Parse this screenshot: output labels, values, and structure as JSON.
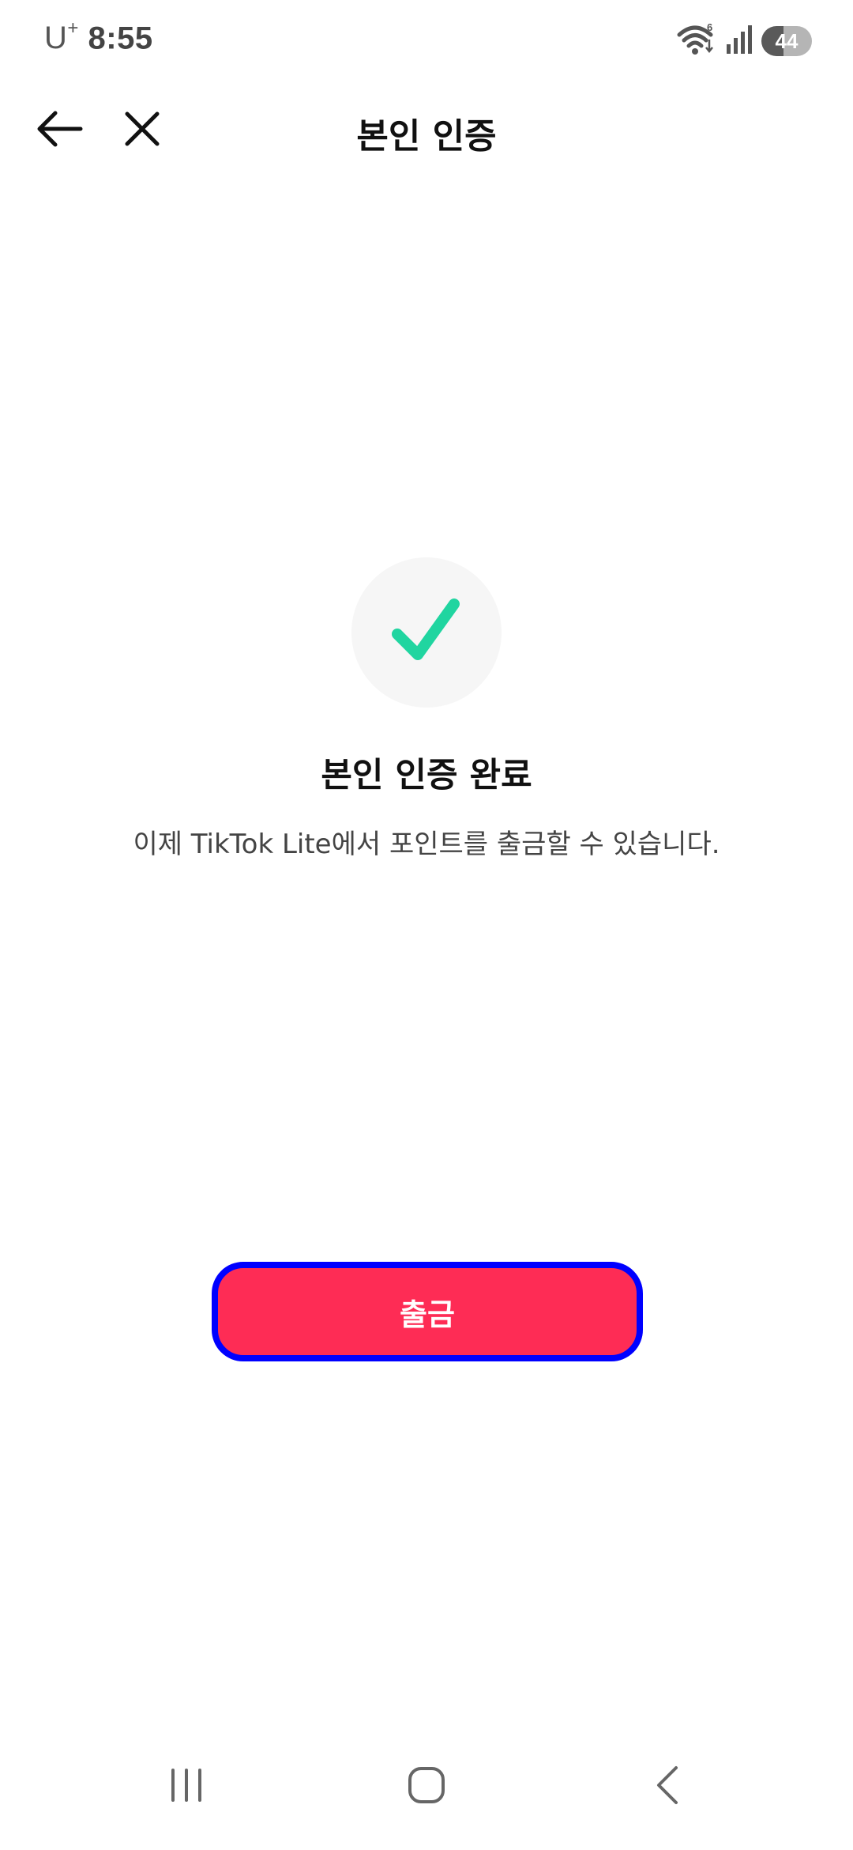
{
  "status_bar": {
    "carrier": "U",
    "carrier_superscript": "+",
    "time": "8:55",
    "wifi_badge": "6",
    "battery_level": "44"
  },
  "app_bar": {
    "title": "본인 인증"
  },
  "success": {
    "title": "본인 인증 완료",
    "description": "이제 TikTok Lite에서 포인트를 출금할 수 있습니다."
  },
  "actions": {
    "withdraw_label": "출금"
  },
  "colors": {
    "accent": "#fe2c55",
    "check": "#20d5a0",
    "highlight_border": "#0000ff"
  },
  "icons": {
    "back": "arrow-left-icon",
    "close": "close-icon",
    "check": "check-icon",
    "wifi": "wifi-icon",
    "signal": "signal-icon",
    "battery": "battery-icon",
    "recents": "recents-icon",
    "home": "home-icon",
    "nav_back": "chevron-left-icon"
  }
}
